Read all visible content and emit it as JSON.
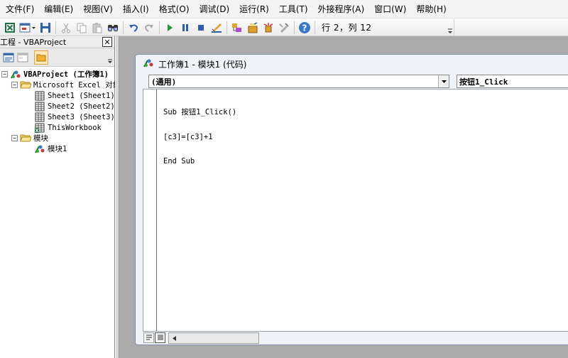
{
  "menu": {
    "items": [
      "文件(F)",
      "编辑(E)",
      "视图(V)",
      "插入(I)",
      "格式(O)",
      "调试(D)",
      "运行(R)",
      "工具(T)",
      "外接程序(A)",
      "窗口(W)",
      "帮助(H)"
    ]
  },
  "toolbar": {
    "status": "行 2，列 12",
    "buttons": [
      "excel-icon",
      "insert-userform-icon",
      "save-icon",
      "cut-icon",
      "copy-icon",
      "paste-icon",
      "find-icon",
      "undo-icon",
      "redo-icon",
      "run-icon",
      "break-icon",
      "reset-icon",
      "design-mode-icon",
      "project-explorer-icon",
      "properties-icon",
      "object-browser-icon",
      "toolbox-icon",
      "help-icon"
    ]
  },
  "project_panel": {
    "title": "工程 - VBAProject",
    "close_label": "✕",
    "tree": [
      {
        "label": "VBAProject (工作簿1)",
        "bold": true,
        "icon": "vba-project-icon",
        "toggle": "−",
        "level": 0
      },
      {
        "label": "Microsoft Excel 对象",
        "bold": false,
        "icon": "folder-open-icon",
        "toggle": "−",
        "level": 1
      },
      {
        "label": "Sheet1 (Sheet1)",
        "bold": false,
        "icon": "worksheet-icon",
        "toggle": "",
        "level": 2
      },
      {
        "label": "Sheet2 (Sheet2)",
        "bold": false,
        "icon": "worksheet-icon",
        "toggle": "",
        "level": 2
      },
      {
        "label": "Sheet3 (Sheet3)",
        "bold": false,
        "icon": "worksheet-icon",
        "toggle": "",
        "level": 2
      },
      {
        "label": "ThisWorkbook",
        "bold": false,
        "icon": "workbook-icon",
        "toggle": "",
        "level": 2
      },
      {
        "label": "模块",
        "bold": false,
        "icon": "folder-open-icon",
        "toggle": "−",
        "level": 1
      },
      {
        "label": "模块1",
        "bold": false,
        "icon": "module-icon",
        "toggle": "",
        "level": 2
      }
    ]
  },
  "code_window": {
    "title": "工作簿1 - 模块1 (代码)",
    "object_combo": "(通用)",
    "procedure_combo": "按钮1_Click",
    "code_lines": [
      "Sub 按钮1_Click()",
      "[c3]=[c3]+1",
      "End Sub"
    ]
  },
  "colors": {
    "menubar_bg": "#f3f3f3",
    "mdi_bg": "#ababab",
    "code_window_bg": "#eff3f8"
  }
}
